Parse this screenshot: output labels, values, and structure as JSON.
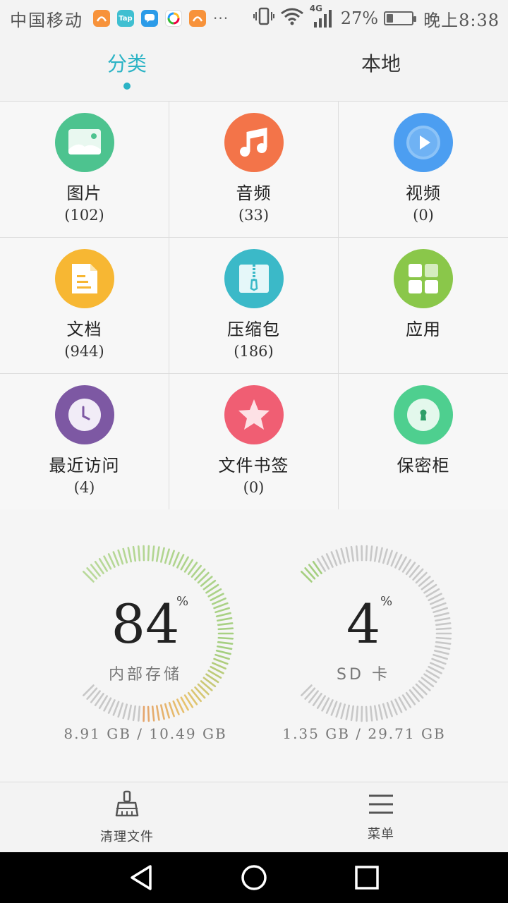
{
  "status_bar": {
    "carrier": "中国移动",
    "network": "4G",
    "battery": "27%",
    "battery_level": 0.27,
    "time": "晚上8:38",
    "notification_icons": [
      "uc-browser-icon",
      "taptap-icon",
      "message-icon",
      "app-store-icon",
      "uc-browser-icon"
    ],
    "more": "···"
  },
  "tabs": [
    {
      "label": "分类",
      "active": true
    },
    {
      "label": "本地",
      "active": false
    }
  ],
  "categories": [
    {
      "label": "图片",
      "count": "(102)",
      "icon": "image-icon",
      "color": "#4dc38f"
    },
    {
      "label": "音频",
      "count": "(33)",
      "icon": "music-icon",
      "color": "#f37449"
    },
    {
      "label": "视频",
      "count": "(0)",
      "icon": "video-icon",
      "color": "#4c9ef1"
    },
    {
      "label": "文档",
      "count": "(944)",
      "icon": "document-icon",
      "color": "#f7b733"
    },
    {
      "label": "压缩包",
      "count": "(186)",
      "icon": "zip-icon",
      "color": "#3bb9c8"
    },
    {
      "label": "应用",
      "count": "",
      "icon": "apps-icon",
      "color": "#8ac74a"
    },
    {
      "label": "最近访问",
      "count": "(4)",
      "icon": "clock-icon",
      "color": "#7d58a3"
    },
    {
      "label": "文件书签",
      "count": "(0)",
      "icon": "star-icon",
      "color": "#f05e73"
    },
    {
      "label": "保密柜",
      "count": "",
      "icon": "lock-icon",
      "color": "#4ecf8f"
    }
  ],
  "storage": {
    "internal": {
      "percent": "84",
      "percent_sign": "%",
      "label": "内部存储",
      "capacity": "8.91 GB / 10.49 GB",
      "usage": 0.84
    },
    "sd": {
      "percent": "4",
      "percent_sign": "%",
      "label": "SD 卡",
      "capacity": "1.35 GB / 29.71 GB",
      "usage": 0.04
    }
  },
  "bottom": {
    "clean_label": "清理文件",
    "menu_label": "菜单"
  },
  "nav": [
    "back-icon",
    "home-icon",
    "recents-icon"
  ]
}
